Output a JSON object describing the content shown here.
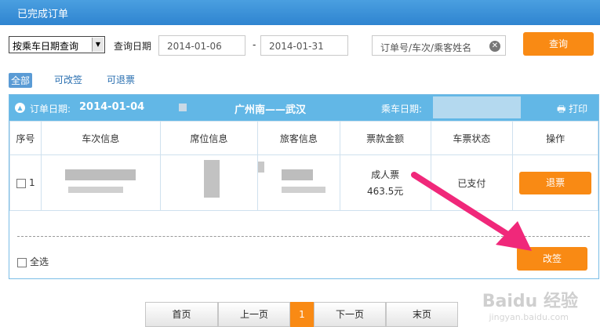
{
  "window": {
    "title": "已完成订单"
  },
  "search": {
    "query_type": "按乘车日期查询",
    "date_label": "查询日期",
    "start_date": "2014-01-06",
    "date_separator": "-",
    "end_date": "2014-01-31",
    "keyword_placeholder": "订单号/车次/乘客姓名",
    "query_button": "查询"
  },
  "filters": [
    "全部",
    "可改签",
    "可退票"
  ],
  "order": {
    "order_date_label": "订单日期:",
    "order_date": "2014-01-04",
    "route": "广州南——武汉",
    "ride_date_label": "乘车日期:",
    "print_label": "打印",
    "columns": [
      "序号",
      "车次信息",
      "席位信息",
      "旅客信息",
      "票款金额",
      "车票状态",
      "操作"
    ],
    "rows": [
      {
        "index": "1",
        "ticket_type": "成人票",
        "price": "463.5元",
        "status": "已支付",
        "action": "退票"
      }
    ],
    "select_all_label": "全选",
    "change_button": "改签"
  },
  "pagination": {
    "first": "首页",
    "prev": "上一页",
    "current": "1",
    "next": "下一页",
    "last": "末页"
  },
  "watermark": {
    "brand": "Baidu 经验",
    "url": "jingyan.baidu.com"
  },
  "colors": {
    "accent": "#f98a14",
    "header": "#62b7e6",
    "arrow": "#f0287a"
  }
}
